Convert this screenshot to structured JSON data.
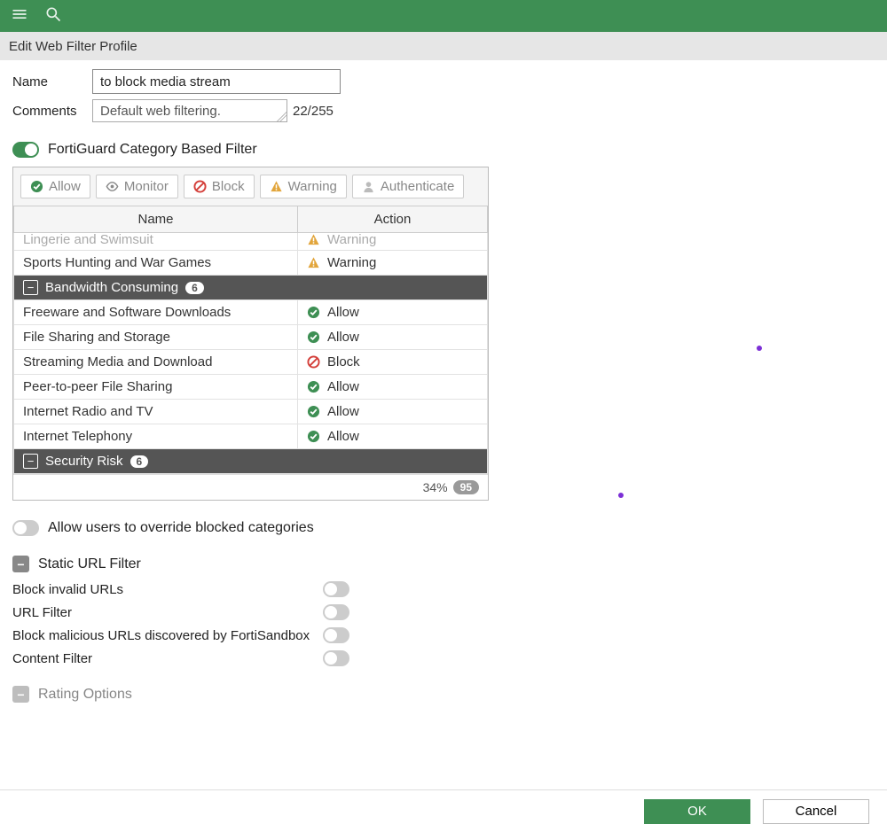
{
  "header": {
    "title": "Edit Web Filter Profile"
  },
  "form": {
    "name_label": "Name",
    "name_value": "to block media stream",
    "comments_label": "Comments",
    "comments_value": "Default web filtering.",
    "char_count": "22/255"
  },
  "fortiguard": {
    "title": "FortiGuard Category Based Filter",
    "enabled": true,
    "buttons": {
      "allow": "Allow",
      "monitor": "Monitor",
      "block": "Block",
      "warning": "Warning",
      "authenticate": "Authenticate"
    },
    "columns": {
      "name": "Name",
      "action": "Action"
    },
    "partial_rows": [
      {
        "name": "Lingerie and Swimsuit",
        "action": "Warning",
        "icon": "warn"
      },
      {
        "name": "Sports Hunting and War Games",
        "action": "Warning",
        "icon": "warn"
      }
    ],
    "group_bw": {
      "label": "Bandwidth Consuming",
      "count": "6"
    },
    "bw_rows": [
      {
        "name": "Freeware and Software Downloads",
        "action": "Allow",
        "icon": "allow"
      },
      {
        "name": "File Sharing and Storage",
        "action": "Allow",
        "icon": "allow"
      },
      {
        "name": "Streaming Media and Download",
        "action": "Block",
        "icon": "block"
      },
      {
        "name": "Peer-to-peer File Sharing",
        "action": "Allow",
        "icon": "allow"
      },
      {
        "name": "Internet Radio and TV",
        "action": "Allow",
        "icon": "allow"
      },
      {
        "name": "Internet Telephony",
        "action": "Allow",
        "icon": "allow"
      }
    ],
    "group_sec": {
      "label": "Security Risk",
      "count": "6"
    },
    "footer": {
      "percent": "34%",
      "total": "95"
    }
  },
  "override": {
    "label": "Allow users to override blocked categories"
  },
  "static_url": {
    "title": "Static URL Filter",
    "opts": {
      "block_invalid": "Block invalid URLs",
      "url_filter": "URL Filter",
      "block_malicious": "Block malicious URLs discovered by FortiSandbox",
      "content_filter": "Content Filter"
    }
  },
  "rating": {
    "title": "Rating Options"
  },
  "footer": {
    "ok": "OK",
    "cancel": "Cancel"
  }
}
